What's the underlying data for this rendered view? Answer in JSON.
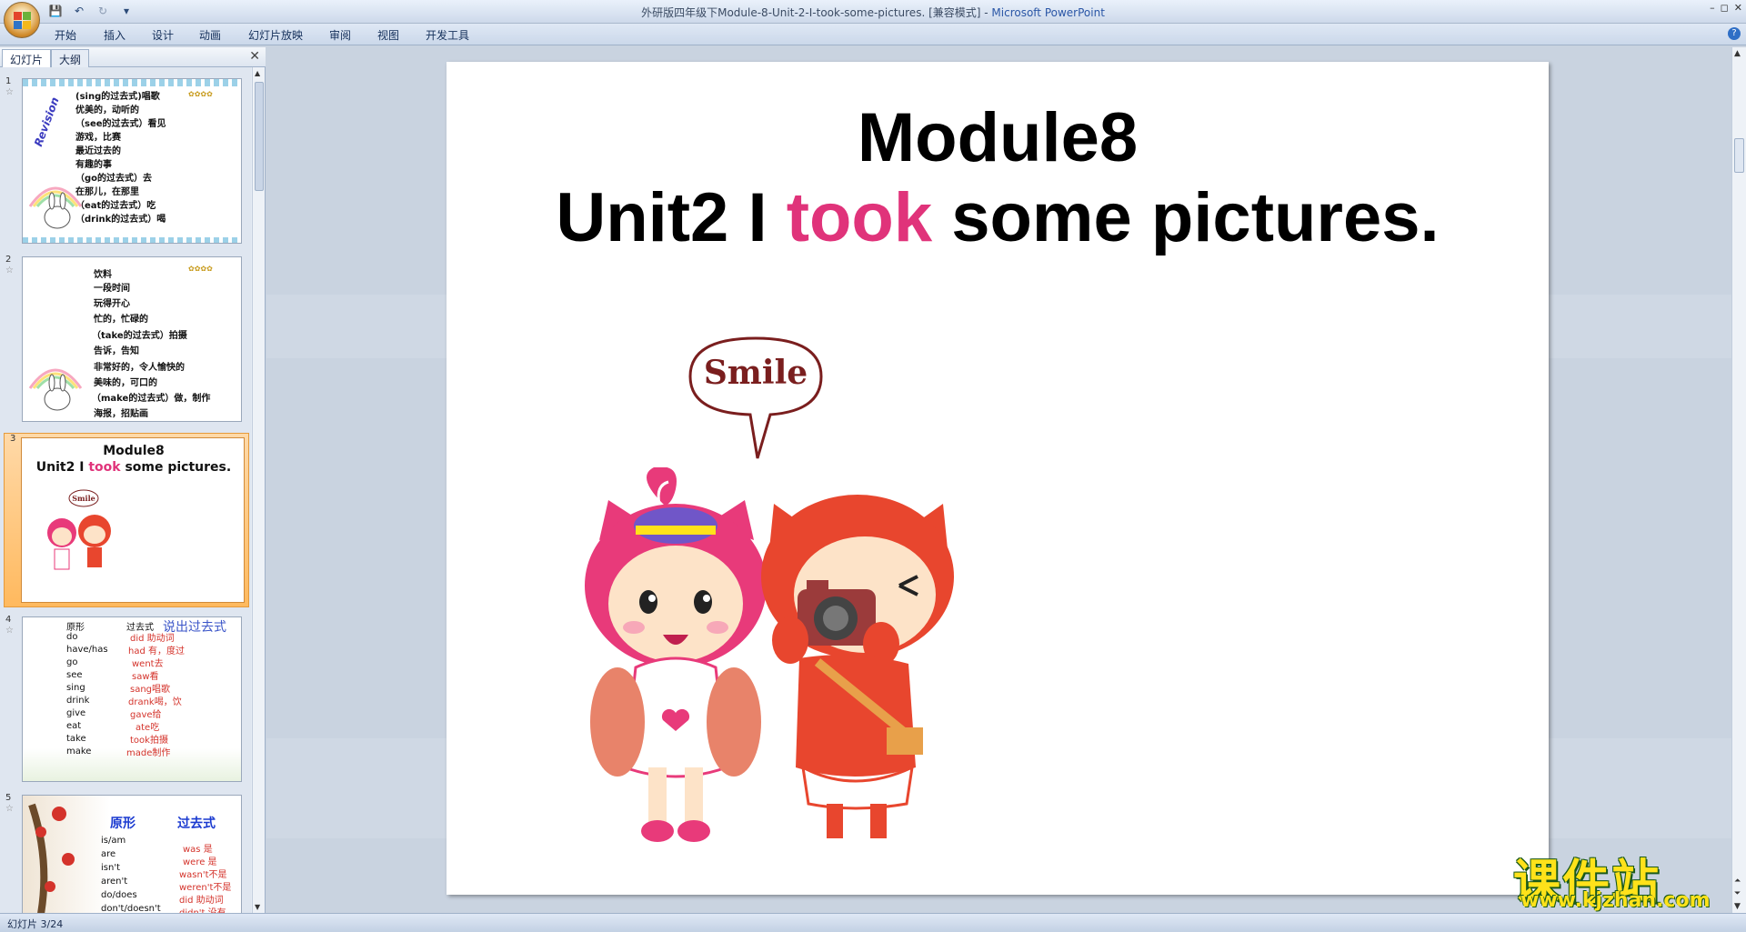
{
  "window": {
    "title_doc": "外研版四年级下Module-8-Unit-2-I-took-some-pictures. [兼容模式]",
    "title_sep": " - ",
    "title_app": "Microsoft PowerPoint"
  },
  "quick_access": {
    "save": "💾",
    "undo": "↶",
    "redo": "↻",
    "more": "▾"
  },
  "window_buttons": {
    "minimize": "–",
    "restore": "◻",
    "close": "✕"
  },
  "ribbon_tabs": [
    "开始",
    "插入",
    "设计",
    "动画",
    "幻灯片放映",
    "审阅",
    "视图",
    "开发工具"
  ],
  "help": "?",
  "left_panel": {
    "tab_slides": "幻灯片",
    "tab_outline": "大纲",
    "close": "✕"
  },
  "thumbnails": {
    "s1": {
      "num": "1",
      "side": "Revision",
      "lines": [
        "(sing的过去式)唱歌",
        "优美的，动听的",
        "（see的过去式）看见",
        "游戏，比赛",
        "最近过去的",
        "有趣的事",
        "（go的过去式）去",
        "在那儿，在那里",
        "（eat的过去式）吃",
        "（drink的过去式）喝"
      ]
    },
    "s2": {
      "num": "2",
      "lines": [
        "饮料",
        "一段时间",
        "玩得开心",
        "忙的，忙碌的",
        "（take的过去式）拍摄",
        "告诉，告知",
        "非常好的，令人愉快的",
        "美味的，可口的",
        "（make的过去式）做，制作",
        "海报，招贴画"
      ]
    },
    "s3": {
      "num": "3",
      "title": "Module8",
      "sub_a": "Unit2 I ",
      "sub_took": "took",
      "sub_b": " some pictures.",
      "bubble": "Smile"
    },
    "s4": {
      "num": "4",
      "header_base": "原形",
      "header_past": "过去式",
      "heading": "说出过去式",
      "base": [
        "do",
        "have/has",
        "go",
        "see",
        "sing",
        "drink",
        "give",
        "eat",
        "take",
        "make"
      ],
      "past": [
        "did 助动词",
        "had 有，度过",
        "went去",
        "saw看",
        "sang唱歌",
        "drank喝，饮",
        "gave给",
        "ate吃",
        "took拍摄",
        "made制作"
      ]
    },
    "s5": {
      "num": "5",
      "header_base": "原形",
      "header_past": "过去式",
      "base": [
        "is/am",
        "are",
        "isn't",
        "aren't",
        "do/does",
        "don't/doesn't"
      ],
      "past": [
        "was 是",
        "were 是",
        "wasn't不是",
        "weren't不是",
        "did 助动词",
        "didn't 没有"
      ]
    }
  },
  "slide": {
    "title": "Module8",
    "subtitle_a": "Unit2 I ",
    "subtitle_took": "took",
    "subtitle_b": " some pictures.",
    "bubble": "Smile",
    "colors": {
      "accent": "#e0337a",
      "pink_cat": "#e83a7a",
      "red_cat": "#e8462e"
    }
  },
  "status": {
    "slide_counter": "幻灯片 3/24"
  },
  "watermark": {
    "text": "课件站",
    "url": "www.kjzhan.com"
  }
}
